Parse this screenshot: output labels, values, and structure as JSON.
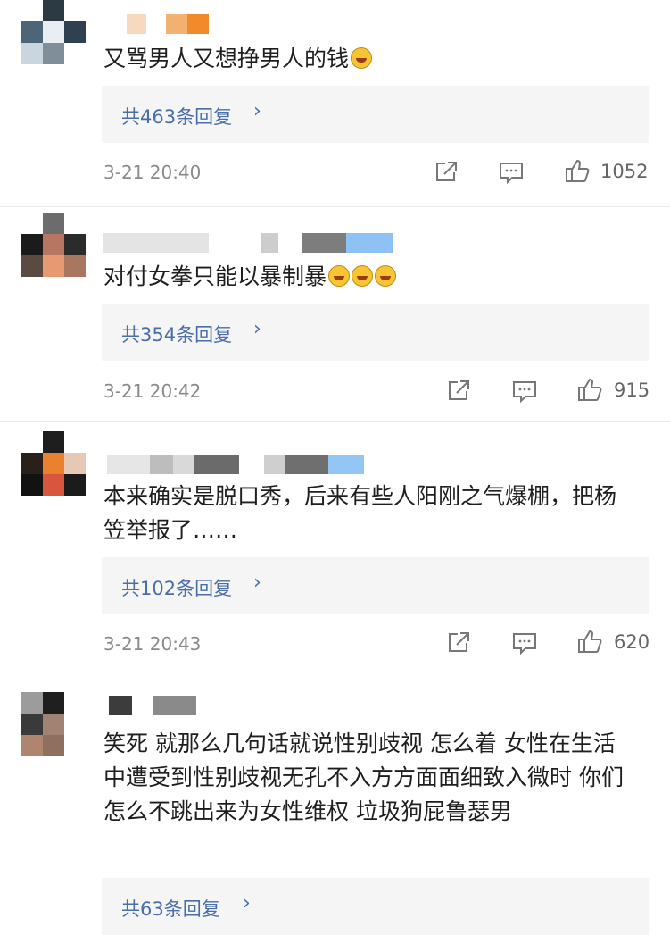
{
  "comments": [
    {
      "text": "又骂男人又想挣男人的钱",
      "emoji_count": 1,
      "replies": "共463条回复",
      "time": "3-21 20:40",
      "likes": "1052"
    },
    {
      "text": "对付女拳只能以暴制暴",
      "emoji_count": 3,
      "replies": "共354条回复",
      "time": "3-21 20:42",
      "likes": "915"
    },
    {
      "text": "本来确实是脱口秀，后来有些人阳刚之气爆棚，把杨笠举报了……",
      "emoji_count": 0,
      "replies": "共102条回复",
      "time": "3-21 20:43",
      "likes": "620"
    },
    {
      "text": "笑死 就那么几句话就说性别歧视 怎么着 女性在生活中遭受到性别歧视无孔不入方方面面细致入微时 你们怎么不跳出来为女性维权 垃圾狗屁鲁瑟男",
      "emoji_count": 0,
      "replies": "共63条回复",
      "time": "",
      "likes": ""
    }
  ],
  "reply_chevron": "›",
  "icons": [
    "share-icon",
    "comment-icon",
    "like-icon",
    "emoji-laugh-icon"
  ],
  "colors": {
    "link": "#4a6ea8",
    "reply_bg": "#f5f5f5",
    "meta": "#8a8a8a"
  }
}
